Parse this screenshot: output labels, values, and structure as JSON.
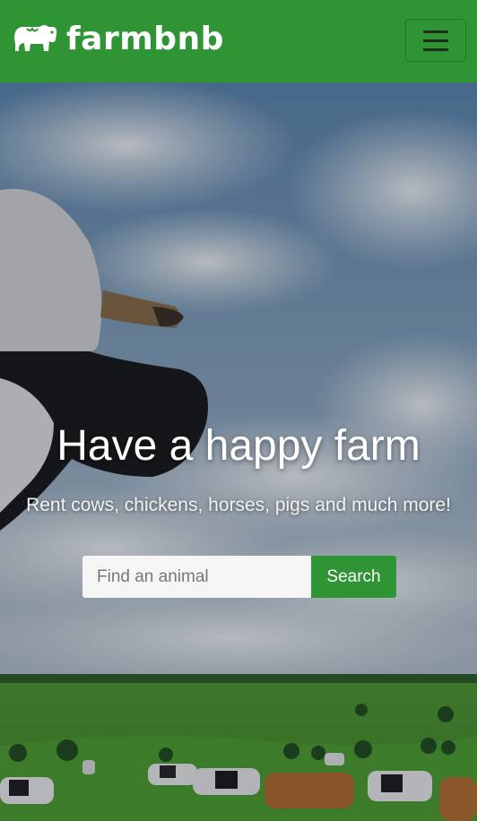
{
  "navbar": {
    "brand_name": "farmbnb",
    "brand_color": "#2f9434",
    "logo_icon": "cow-icon",
    "menu_icon": "hamburger-menu-icon"
  },
  "hero": {
    "title": "Have a happy farm",
    "subtitle": "Rent cows, chickens, horses, pigs and much more!",
    "background": "cow-pasture-photo"
  },
  "search": {
    "placeholder": "Find an animal",
    "value": "",
    "button_label": "Search",
    "button_color": "#2f9434"
  }
}
